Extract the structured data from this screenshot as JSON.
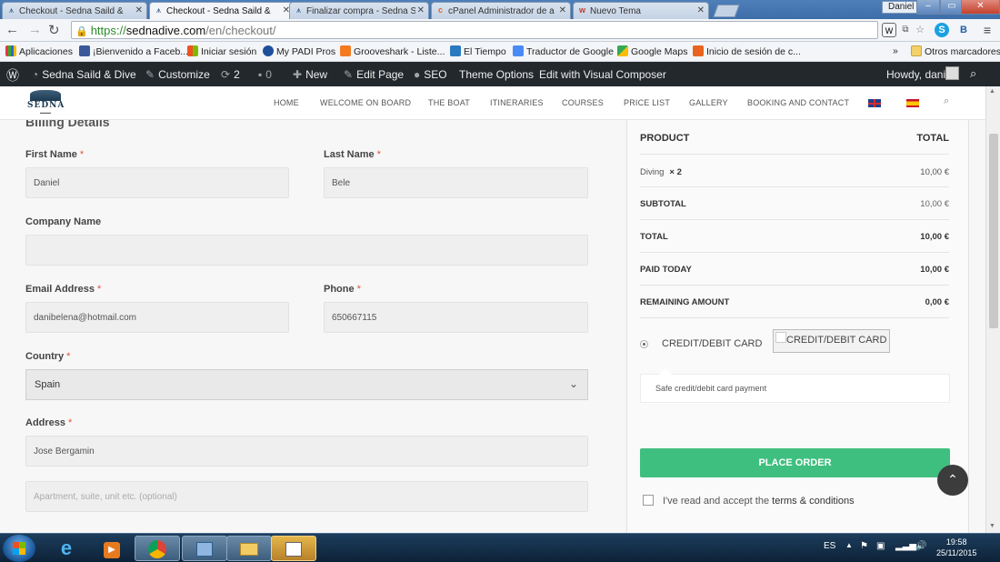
{
  "browser": {
    "tabs": [
      {
        "label": "Checkout - Sedna Saild &"
      },
      {
        "label": "Checkout - Sedna Saild &"
      },
      {
        "label": "Finalizar compra - Sedna S"
      },
      {
        "label": "cPanel Administrador de a"
      },
      {
        "label": "Nuevo Tema"
      }
    ],
    "window_user": "Daniel",
    "url": {
      "scheme": "https://",
      "host": "sednadive.com",
      "path": "/en/checkout/"
    },
    "bookmarks": [
      "Aplicaciones",
      "¡Bienvenido a Faceb...",
      "Iniciar sesión",
      "My PADI Pros",
      "Grooveshark - Liste...",
      "El Tiempo",
      "Traductor de Google",
      "Google Maps",
      "Inicio de sesión de c..."
    ],
    "bookmarks_overflow": "»",
    "other_bookmarks": "Otros marcadores"
  },
  "wp_admin_bar": {
    "site_name": "Sedna Saild & Dive",
    "customize": "Customize",
    "updates_count": "2",
    "comments_count": "0",
    "new": "New",
    "edit_page": "Edit Page",
    "seo": "SEO",
    "theme_options": "Theme Options",
    "visual_composer": "Edit with Visual Composer",
    "howdy": "Howdy, dani"
  },
  "site": {
    "logo_text": "SEDNA",
    "menu": [
      "HOME",
      "WELCOME ON BOARD",
      "THE BOAT",
      "ITINERARIES",
      "COURSES",
      "PRICE LIST",
      "GALLERY",
      "BOOKING AND CONTACT"
    ]
  },
  "billing": {
    "title": "Billing Details",
    "required_mark": "*",
    "first_name": {
      "label": "First Name",
      "value": "Daniel"
    },
    "last_name": {
      "label": "Last Name",
      "value": "Bele"
    },
    "company": {
      "label": "Company Name",
      "value": ""
    },
    "email": {
      "label": "Email Address",
      "value": "danibelena@hotmail.com"
    },
    "phone": {
      "label": "Phone",
      "value": "650667115"
    },
    "country": {
      "label": "Country",
      "value": "Spain"
    },
    "address": {
      "label": "Address",
      "value": "Jose Bergamin",
      "placeholder2": "Apartment, suite, unit etc. (optional)"
    }
  },
  "order": {
    "header_product": "PRODUCT",
    "header_total": "TOTAL",
    "item_name": "Diving",
    "item_qty": "× 2",
    "item_total": "10,00 €",
    "subtotal_label": "SUBTOTAL",
    "subtotal": "10,00 €",
    "total_label": "TOTAL",
    "total": "10,00 €",
    "paid_label": "PAID TODAY",
    "paid": "10,00 €",
    "remaining_label": "REMAINING AMOUNT",
    "remaining": "0,00 €",
    "payment_method": "CREDIT/DEBIT CARD",
    "payment_image_alt": "CREDIT/DEBIT CARD",
    "payment_desc": "Safe credit/debit card payment",
    "place_order": "PLACE ORDER",
    "terms_prefix": "I've read and accept the",
    "terms_link": "terms & conditions"
  },
  "taskbar": {
    "lang": "ES",
    "time": "19:58",
    "date": "25/11/2015"
  },
  "colors": {
    "place_order": "#3fbf7f",
    "admin_bar": "#23282d",
    "required": "#e0533a"
  }
}
